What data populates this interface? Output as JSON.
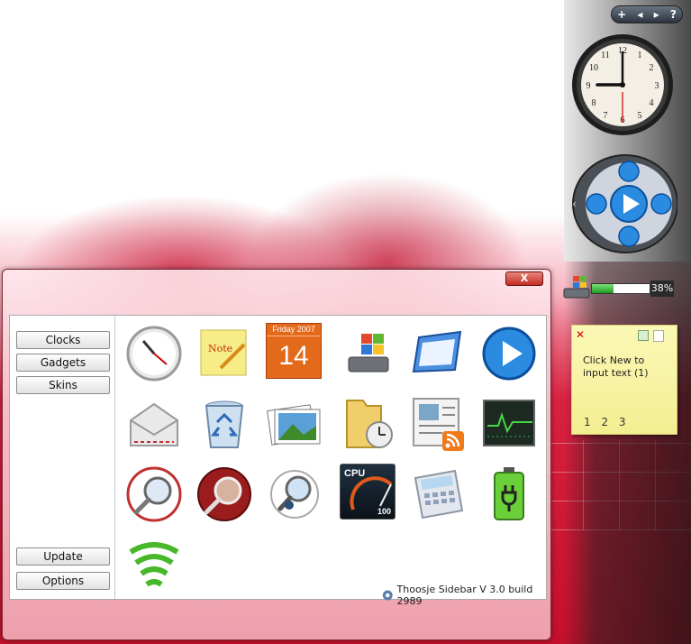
{
  "sidebar": {
    "controls": {
      "add": "+",
      "prev": "◂",
      "next": "▸",
      "help": "?"
    },
    "cpu_meter": {
      "percent_label": "38%",
      "fill_fraction": 0.38
    },
    "note": {
      "text": "Click New to input text (1)",
      "pages": "1 2 3"
    }
  },
  "window": {
    "close_label": "X",
    "menu": {
      "clocks": "Clocks",
      "gadgets": "Gadgets",
      "skins": "Skins",
      "update": "Update",
      "options": "Options"
    },
    "calendar_icon": {
      "day": "Friday 2007",
      "date": "14"
    },
    "cpu_gadget": {
      "label": "CPU",
      "value": "100"
    },
    "note_icon": {
      "label": "Note"
    },
    "status": "Thoosje Sidebar V 3.0  build 2989"
  },
  "colors": {
    "accent_red": "#c22c20",
    "note_yellow": "#f4ee92",
    "window_border": "#7d2a34"
  }
}
